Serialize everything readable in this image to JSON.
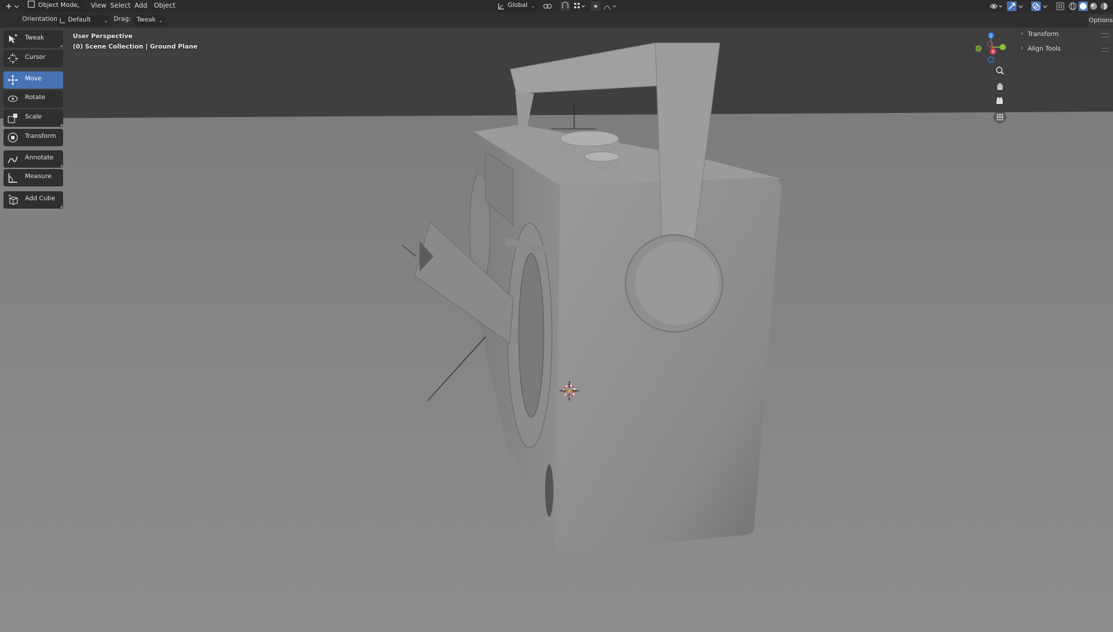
{
  "header": {
    "editor_type_icon": "3d-viewport-icon",
    "mode_label": "Object Mode",
    "menus": [
      "View",
      "Select",
      "Add",
      "Object"
    ],
    "transform_orientation": "Global",
    "shading_modes": [
      "wireframe",
      "solid",
      "material-preview",
      "rendered"
    ],
    "active_shading": "solid"
  },
  "tool_header": {
    "orientation_label": "Orientation:",
    "orientation_value": "Default",
    "drag_label": "Drag:",
    "drag_value": "Tweak",
    "options_label": "Options"
  },
  "toolbar": {
    "tools": [
      {
        "label": "Tweak",
        "icon": "tweak-icon",
        "active": false
      },
      {
        "label": "Cursor",
        "icon": "cursor-icon",
        "active": false
      },
      {
        "label": "Move",
        "icon": "move-icon",
        "active": true
      },
      {
        "label": "Rotate",
        "icon": "rotate-icon",
        "active": false
      },
      {
        "label": "Scale",
        "icon": "scale-icon",
        "active": false
      },
      {
        "label": "Transform",
        "icon": "transform-icon",
        "active": false
      },
      {
        "label": "Annotate",
        "icon": "annotate-icon",
        "active": false
      },
      {
        "label": "Measure",
        "icon": "measure-icon",
        "active": false
      },
      {
        "label": "Add Cube",
        "icon": "add-cube-icon",
        "active": false
      }
    ]
  },
  "viewport": {
    "view_name": "User Perspective",
    "collection_info": "(0) Scene Collection | Ground Plane",
    "accent_color": "#4772b3"
  },
  "nav_gizmo": {
    "axes": {
      "x": "#e04050",
      "y": "#8bbf3c",
      "z": "#3a7cd9"
    }
  },
  "sidebar": {
    "panels": [
      "Transform",
      "Align Tools"
    ]
  }
}
